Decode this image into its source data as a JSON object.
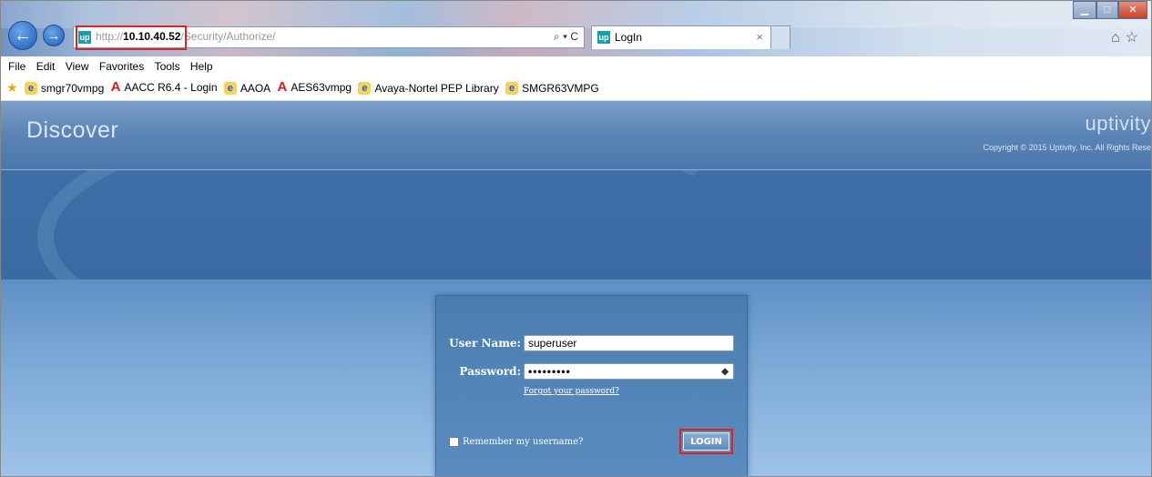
{
  "browser": {
    "back_glyph": "←",
    "forward_glyph": "→",
    "address": {
      "url_prefix": "http://",
      "url_host": "10.10.40.52",
      "url_path": "/Security/Authorize/",
      "tools": "⌕ ▾ C"
    },
    "tab": {
      "favicon": "up",
      "title": "LogIn",
      "close": "×"
    },
    "window_controls": {
      "minimize": "▁",
      "maximize": "□",
      "close": "✕"
    },
    "right_tools": "⌂☆"
  },
  "menu": [
    "File",
    "Edit",
    "View",
    "Favorites",
    "Tools",
    "Help"
  ],
  "favorites": [
    {
      "icon": "ie-icon",
      "label": "smgr70vmpg"
    },
    {
      "icon": "avaya-icon",
      "label": "AACC R6.4 - Login"
    },
    {
      "icon": "ie-icon",
      "label": "AAOA"
    },
    {
      "icon": "avaya-icon",
      "label": "AES63vmpg"
    },
    {
      "icon": "ie-icon",
      "label": "Avaya-Nortel PEP Library"
    },
    {
      "icon": "ie-icon",
      "label": "SMGR63VMPG"
    }
  ],
  "app": {
    "brand": "Discover",
    "logo": "uptivity",
    "copyright": "Copyright © 2015 Uptivity, Inc. All Rights Rese"
  },
  "login": {
    "username_label": "User Name:",
    "username_value": "superuser",
    "password_label": "Password:",
    "password_value": "•••••••••",
    "reveal_glyph": "◆",
    "forgot_link": "Forgot your password?",
    "remember_label": "Remember my username?",
    "login_button": "LOGIN"
  },
  "colors": {
    "highlight": "#dd2222",
    "header": "#5d86b7",
    "panel": "#4a7db1"
  }
}
